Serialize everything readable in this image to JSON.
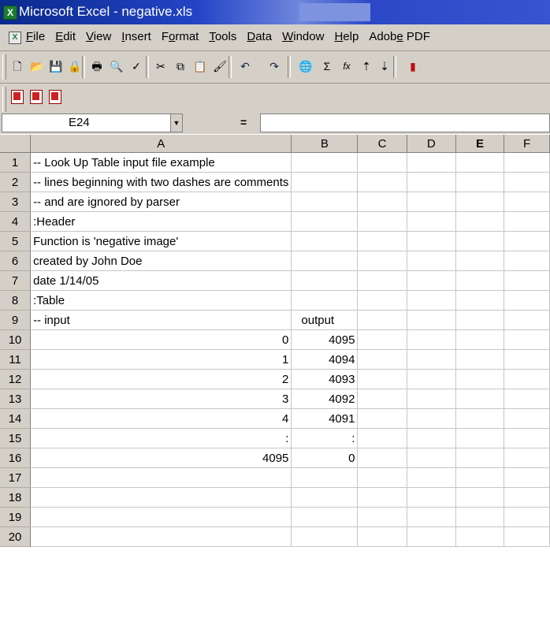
{
  "window": {
    "title": "Microsoft Excel - negative.xls",
    "app_icon_text": "X"
  },
  "menubar": {
    "items": [
      {
        "label": "File"
      },
      {
        "label": "Edit"
      },
      {
        "label": "View"
      },
      {
        "label": "Insert"
      },
      {
        "label": "Format"
      },
      {
        "label": "Tools"
      },
      {
        "label": "Data"
      },
      {
        "label": "Window"
      },
      {
        "label": "Help"
      },
      {
        "label": "Adobe PDF"
      }
    ]
  },
  "toolbar": {
    "icons": [
      "new-icon",
      "open-icon",
      "save-icon",
      "permission-icon",
      "print-icon",
      "print-preview-icon",
      "spelling-icon",
      "cut-icon",
      "copy-icon",
      "paste-icon",
      "format-painter-icon",
      "undo-icon",
      "redo-icon",
      "hyperlink-icon",
      "autosum-icon",
      "function-icon",
      "sort-ascending-icon",
      "sort-descending-icon",
      "chart-wizard-icon"
    ],
    "glyphs": {
      "autosum": "Σ",
      "function": "fx"
    }
  },
  "pdf_toolbar": {
    "icons": [
      "convert-to-pdf-icon",
      "convert-and-email-icon",
      "convert-and-review-icon"
    ]
  },
  "formula_bar": {
    "name_box": "E24",
    "equals": "=",
    "formula": ""
  },
  "columns": [
    "A",
    "B",
    "C",
    "D",
    "E",
    "F"
  ],
  "active_column": "E",
  "rows": [
    {
      "n": "1",
      "a": "-- Look Up Table input file example",
      "b": ""
    },
    {
      "n": "2",
      "a": "-- lines beginning with two dashes are comments",
      "b": ""
    },
    {
      "n": "3",
      "a": "-- and are ignored by parser",
      "b": ""
    },
    {
      "n": "4",
      "a": ":Header",
      "b": ""
    },
    {
      "n": "5",
      "a": "Function is 'negative image'",
      "b": ""
    },
    {
      "n": "6",
      "a": "created by John Doe",
      "b": ""
    },
    {
      "n": "7",
      "a": "date 1/14/05",
      "b": ""
    },
    {
      "n": "8",
      "a": ":Table",
      "b": ""
    },
    {
      "n": "9",
      "a": "-- input",
      "b": "output"
    },
    {
      "n": "10",
      "a": "0",
      "b": "4095"
    },
    {
      "n": "11",
      "a": "1",
      "b": "4094"
    },
    {
      "n": "12",
      "a": "2",
      "b": "4093"
    },
    {
      "n": "13",
      "a": "3",
      "b": "4092"
    },
    {
      "n": "14",
      "a": "4",
      "b": "4091"
    },
    {
      "n": "15",
      "a": ":",
      "b": ":"
    },
    {
      "n": "16",
      "a": "4095",
      "b": "0"
    },
    {
      "n": "17",
      "a": "",
      "b": ""
    },
    {
      "n": "18",
      "a": "",
      "b": ""
    },
    {
      "n": "19",
      "a": "",
      "b": ""
    },
    {
      "n": "20",
      "a": "",
      "b": ""
    }
  ]
}
